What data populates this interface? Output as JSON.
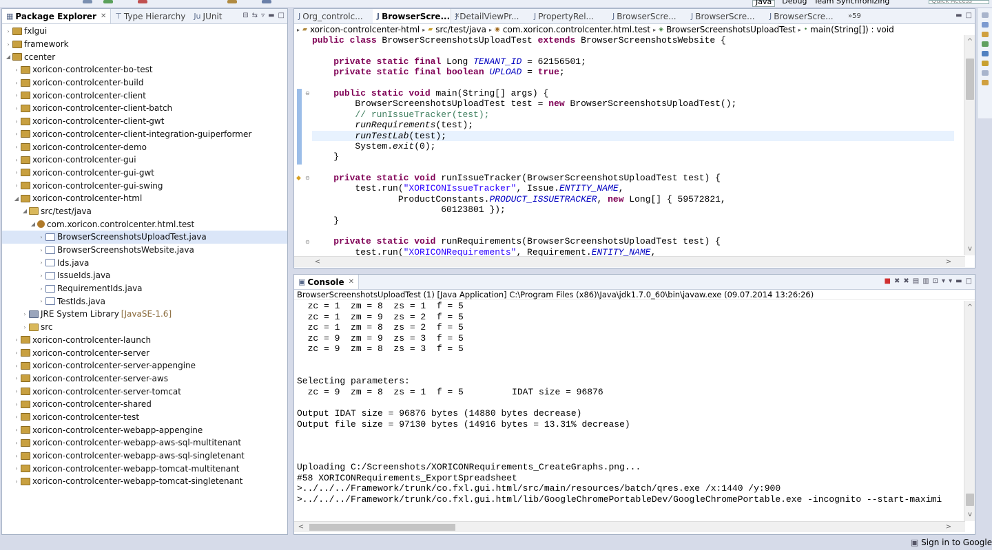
{
  "perspectives": {
    "java": "Java",
    "debug": "Debug",
    "team": "Team Synchronizing",
    "quick_access": "Quick Access"
  },
  "explorer": {
    "tabs": [
      {
        "label": "Package Explorer",
        "active": true
      },
      {
        "label": "Type Hierarchy",
        "active": false
      },
      {
        "label": "JUnit",
        "active": false
      }
    ],
    "items": [
      {
        "label": "fxlgui",
        "level": 0,
        "icon": "project-icon",
        "twisty": "closed"
      },
      {
        "label": "framework",
        "level": 0,
        "icon": "project-icon",
        "twisty": "closed"
      },
      {
        "label": "ccenter",
        "level": 0,
        "icon": "project-icon",
        "twisty": "open"
      },
      {
        "label": "xoricon-controlcenter-bo-test",
        "level": 1,
        "icon": "project-icon",
        "twisty": "closed"
      },
      {
        "label": "xoricon-controlcenter-build",
        "level": 1,
        "icon": "project-icon",
        "twisty": "closed"
      },
      {
        "label": "xoricon-controlcenter-client",
        "level": 1,
        "icon": "project-icon",
        "twisty": "closed"
      },
      {
        "label": "xoricon-controlcenter-client-batch",
        "level": 1,
        "icon": "project-icon",
        "twisty": "closed"
      },
      {
        "label": "xoricon-controlcenter-client-gwt",
        "level": 1,
        "icon": "project-icon",
        "twisty": "closed"
      },
      {
        "label": "xoricon-controlcenter-client-integration-guiperformer",
        "level": 1,
        "icon": "project-icon",
        "twisty": "closed"
      },
      {
        "label": "xoricon-controlcenter-demo",
        "level": 1,
        "icon": "project-icon",
        "twisty": "closed"
      },
      {
        "label": "xoricon-controlcenter-gui",
        "level": 1,
        "icon": "project-icon",
        "twisty": "closed"
      },
      {
        "label": "xoricon-controlcenter-gui-gwt",
        "level": 1,
        "icon": "project-icon",
        "twisty": "closed"
      },
      {
        "label": "xoricon-controlcenter-gui-swing",
        "level": 1,
        "icon": "project-icon",
        "twisty": "closed"
      },
      {
        "label": "xoricon-controlcenter-html",
        "level": 1,
        "icon": "project-icon",
        "twisty": "open"
      },
      {
        "label": "src/test/java",
        "level": 2,
        "icon": "source-folder-icon",
        "twisty": "open"
      },
      {
        "label": "com.xoricon.controlcenter.html.test",
        "level": 3,
        "icon": "package-icon",
        "twisty": "open"
      },
      {
        "label": "BrowserScreenshotsUploadTest.java",
        "level": 4,
        "icon": "java-file-icon",
        "twisty": "closed",
        "selected": true
      },
      {
        "label": "BrowserScreenshotsWebsite.java",
        "level": 4,
        "icon": "java-file-icon",
        "twisty": "closed"
      },
      {
        "label": "Ids.java",
        "level": 4,
        "icon": "java-file-icon",
        "twisty": "closed"
      },
      {
        "label": "IssueIds.java",
        "level": 4,
        "icon": "java-file-icon",
        "twisty": "closed"
      },
      {
        "label": "RequirementIds.java",
        "level": 4,
        "icon": "java-file-icon",
        "twisty": "closed"
      },
      {
        "label": "TestIds.java",
        "level": 4,
        "icon": "java-file-icon",
        "twisty": "closed"
      },
      {
        "label": "JRE System Library",
        "suffix": "[JavaSE-1.6]",
        "level": 2,
        "icon": "library-icon",
        "twisty": "closed"
      },
      {
        "label": "src",
        "level": 2,
        "icon": "folder-icon",
        "twisty": "closed"
      },
      {
        "label": "xoricon-controlcenter-launch",
        "level": 1,
        "icon": "project-icon",
        "twisty": "closed"
      },
      {
        "label": "xoricon-controlcenter-server",
        "level": 1,
        "icon": "project-icon",
        "twisty": "closed"
      },
      {
        "label": "xoricon-controlcenter-server-appengine",
        "level": 1,
        "icon": "project-icon",
        "twisty": "closed"
      },
      {
        "label": "xoricon-controlcenter-server-aws",
        "level": 1,
        "icon": "project-icon",
        "twisty": "closed"
      },
      {
        "label": "xoricon-controlcenter-server-tomcat",
        "level": 1,
        "icon": "project-icon",
        "twisty": "closed"
      },
      {
        "label": "xoricon-controlcenter-shared",
        "level": 1,
        "icon": "project-icon",
        "twisty": "closed"
      },
      {
        "label": "xoricon-controlcenter-test",
        "level": 1,
        "icon": "project-icon",
        "twisty": "closed"
      },
      {
        "label": "xoricon-controlcenter-webapp-appengine",
        "level": 1,
        "icon": "project-icon",
        "twisty": "closed"
      },
      {
        "label": "xoricon-controlcenter-webapp-aws-sql-multitenant",
        "level": 1,
        "icon": "project-icon",
        "twisty": "closed"
      },
      {
        "label": "xoricon-controlcenter-webapp-aws-sql-singletenant",
        "level": 1,
        "icon": "project-icon",
        "twisty": "closed"
      },
      {
        "label": "xoricon-controlcenter-webapp-tomcat-multitenant",
        "level": 1,
        "icon": "project-icon",
        "twisty": "closed"
      },
      {
        "label": "xoricon-controlcenter-webapp-tomcat-singletenant",
        "level": 1,
        "icon": "project-icon",
        "twisty": "closed"
      }
    ]
  },
  "editor": {
    "tabs": [
      {
        "label": "Org_controlc...",
        "active": false
      },
      {
        "label": "BrowserScre...",
        "active": true
      },
      {
        "label": "DetailViewPr...",
        "active": false
      },
      {
        "label": "PropertyRel...",
        "active": false
      },
      {
        "label": "BrowserScre...",
        "active": false
      },
      {
        "label": "BrowserScre...",
        "active": false
      },
      {
        "label": "BrowserScre...",
        "active": false
      }
    ],
    "overflow_count": "59",
    "breadcrumb": [
      "xoricon-controlcenter-html",
      "src/test/java",
      "com.xoricon.controlcenter.html.test",
      "BrowserScreenshotsUploadTest",
      "main(String[]) : void"
    ],
    "lines": [
      [
        {
          "t": "public class",
          "c": "kw"
        },
        {
          "t": " BrowserScreenshotsUploadTest "
        },
        {
          "t": "extends",
          "c": "kw"
        },
        {
          "t": " BrowserScreenshotsWebsite {"
        }
      ],
      [],
      [
        {
          "t": "    "
        },
        {
          "t": "private static final",
          "c": "kw"
        },
        {
          "t": " Long "
        },
        {
          "t": "TENANT_ID",
          "c": "fld"
        },
        {
          "t": " = 62156501;"
        }
      ],
      [
        {
          "t": "    "
        },
        {
          "t": "private static final boolean",
          "c": "kw"
        },
        {
          "t": " "
        },
        {
          "t": "UPLOAD",
          "c": "fld"
        },
        {
          "t": " = "
        },
        {
          "t": "true",
          "c": "kw"
        },
        {
          "t": ";"
        }
      ],
      [],
      [
        {
          "t": "    "
        },
        {
          "t": "public static void",
          "c": "kw"
        },
        {
          "t": " main(String[] args) {"
        }
      ],
      [
        {
          "t": "        BrowserScreenshotsUploadTest test = "
        },
        {
          "t": "new",
          "c": "kw"
        },
        {
          "t": " BrowserScreenshotsUploadTest();"
        }
      ],
      [
        {
          "t": "        "
        },
        {
          "t": "// runIssueTracker(test);",
          "c": "cmt"
        }
      ],
      [
        {
          "t": "        "
        },
        {
          "t": "runRequirements",
          "c": "it"
        },
        {
          "t": "(test);"
        }
      ],
      [
        {
          "t": "        "
        },
        {
          "t": "runTestLab",
          "c": "it"
        },
        {
          "t": "(test);"
        }
      ],
      [
        {
          "t": "        System."
        },
        {
          "t": "exit",
          "c": "it"
        },
        {
          "t": "(0);"
        }
      ],
      [
        {
          "t": "    }"
        }
      ],
      [],
      [
        {
          "t": "    "
        },
        {
          "t": "private static void",
          "c": "kw"
        },
        {
          "t": " runIssueTracker(BrowserScreenshotsUploadTest test) {"
        }
      ],
      [
        {
          "t": "        test.run("
        },
        {
          "t": "\"XORICONIssueTracker\"",
          "c": "str"
        },
        {
          "t": ", Issue."
        },
        {
          "t": "ENTITY_NAME",
          "c": "fld"
        },
        {
          "t": ","
        }
      ],
      [
        {
          "t": "                ProductConstants."
        },
        {
          "t": "PRODUCT_ISSUETRACKER",
          "c": "fld"
        },
        {
          "t": ", "
        },
        {
          "t": "new",
          "c": "kw"
        },
        {
          "t": " Long[] { 59572821,"
        }
      ],
      [
        {
          "t": "                        60123801 });"
        }
      ],
      [
        {
          "t": "    }"
        }
      ],
      [],
      [
        {
          "t": "    "
        },
        {
          "t": "private static void",
          "c": "kw"
        },
        {
          "t": " runRequirements(BrowserScreenshotsUploadTest test) {"
        }
      ],
      [
        {
          "t": "        test.run("
        },
        {
          "t": "\"XORICONRequirements\"",
          "c": "str"
        },
        {
          "t": ", Requirement."
        },
        {
          "t": "ENTITY_NAME",
          "c": "fld"
        },
        {
          "t": ","
        }
      ]
    ]
  },
  "console": {
    "tab_label": "Console",
    "header": "BrowserScreenshotsUploadTest (1) [Java Application] C:\\Program Files (x86)\\Java\\jdk1.7.0_60\\bin\\javaw.exe (09.07.2014 13:26:26)",
    "lines": [
      "  zc = 1  zm = 8  zs = 1  f = 5",
      "  zc = 1  zm = 9  zs = 2  f = 5",
      "  zc = 1  zm = 8  zs = 2  f = 5",
      "  zc = 9  zm = 9  zs = 3  f = 5",
      "  zc = 9  zm = 8  zs = 3  f = 5",
      "",
      "",
      "Selecting parameters:",
      "  zc = 9  zm = 8  zs = 1  f = 5         IDAT size = 96876",
      "",
      "Output IDAT size = 96876 bytes (14880 bytes decrease)",
      "Output file size = 97130 bytes (14916 bytes = 13.31% decrease)",
      "",
      "",
      "",
      "Uploading C:/Screenshots/XORICONRequirements_CreateGraphs.png...",
      "#58 XORICONRequirements_ExportSpreadsheet",
      ">../../../Framework/trunk/co.fxl.gui.html/src/main/resources/batch/qres.exe /x:1440 /y:900",
      ">../../../Framework/trunk/co.fxl.gui.html/lib/GoogleChromePortableDev/GoogleChromePortable.exe -incognito --start-maximi"
    ]
  },
  "status": {
    "sign_in": "Sign in to Google..."
  }
}
